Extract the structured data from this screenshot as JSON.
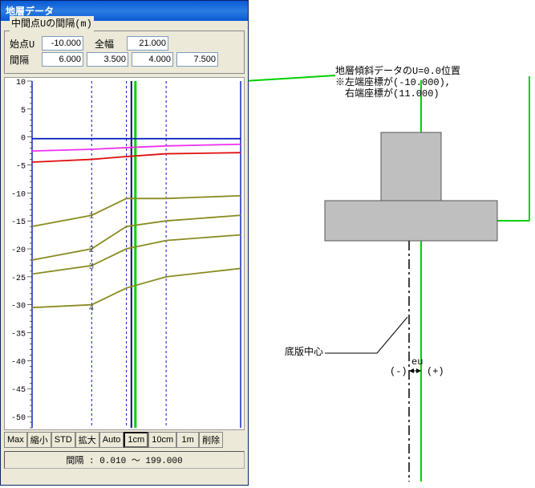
{
  "window": {
    "title": "地層データ"
  },
  "fieldset": {
    "legend": "中間点Uの間隔(m)"
  },
  "labels": {
    "startU": "始点U",
    "fullWidth": "全幅",
    "spacing": "間隔"
  },
  "inputs": {
    "startU": "-10.000",
    "fullWidth": "21.000",
    "spacing": [
      "6.000",
      "3.500",
      "4.000",
      "7.500"
    ]
  },
  "toolbar": {
    "buttons": [
      "Max",
      "縮小",
      "STD",
      "拡大",
      "Auto",
      "1cm",
      "10cm",
      "1m",
      "削除"
    ],
    "selected": 5
  },
  "status": "間隔 : 0.010 ～ 199.000",
  "chart_data": {
    "type": "line",
    "ylabel_ticks": [
      10,
      5,
      0,
      -5,
      -10,
      -15,
      -20,
      -25,
      -30,
      -35,
      -40,
      -45,
      -50
    ],
    "xlim": [
      -10,
      11
    ],
    "ylim": [
      -52,
      10
    ],
    "x_breaks": [
      -10,
      -4,
      -0.5,
      3.5,
      11
    ],
    "marker_labels": [
      "1",
      "2",
      "3",
      "4"
    ],
    "marker_x": -4.3,
    "marker_y": [
      -14,
      -20,
      -23,
      -30.5
    ],
    "series": [
      {
        "name": "layer-top-blue",
        "color": "#0018c0",
        "y": [
          -0.3,
          -0.3,
          -0.3,
          -0.3,
          -0.3
        ]
      },
      {
        "name": "layer-magenta",
        "color": "#f030f0",
        "y": [
          -2.5,
          -2.2,
          -1.9,
          -1.6,
          -1.3
        ]
      },
      {
        "name": "layer-red",
        "color": "#e01010",
        "y": [
          -4.5,
          -4.0,
          -3.5,
          -3.0,
          -2.8
        ]
      },
      {
        "name": "layer-olive-1",
        "color": "#8a8a20",
        "y": [
          -16.0,
          -14.0,
          -11.0,
          -11.0,
          -10.5
        ]
      },
      {
        "name": "layer-olive-2",
        "color": "#8a8a20",
        "y": [
          -22.0,
          -20.0,
          -16.0,
          -15.0,
          -14.0
        ]
      },
      {
        "name": "layer-olive-3",
        "color": "#8a8a20",
        "y": [
          -24.5,
          -23.0,
          -20.0,
          -18.5,
          -17.5
        ]
      },
      {
        "name": "layer-olive-4",
        "color": "#8a8a20",
        "y": [
          -30.5,
          -30.0,
          -27.0,
          -25.0,
          -23.5
        ]
      }
    ],
    "center_line_x": 0,
    "green_line_x": 0
  },
  "right": {
    "annot1": "地層傾斜データのU=0.0位置",
    "annot2": "※左端座標が(-10.000),",
    "annot3": "　右端座標が(11.000)",
    "bottomLabel": "底版中心",
    "minus": "(-)",
    "plus": "(+)",
    "eu": "eu"
  }
}
